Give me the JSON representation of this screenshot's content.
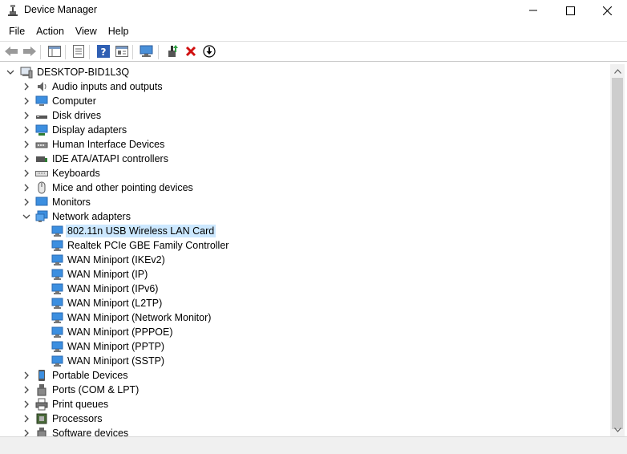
{
  "window": {
    "title": "Device Manager"
  },
  "menu": [
    "File",
    "Action",
    "View",
    "Help"
  ],
  "toolbar": {
    "buttons": [
      "back-icon",
      "forward-icon",
      "properties-icon",
      "refresh-icon",
      "help-icon",
      "view-icon",
      "scan-hardware-icon",
      "update-driver-icon",
      "uninstall-icon",
      "disable-icon"
    ]
  },
  "tree": {
    "root": "DESKTOP-BID1L3Q",
    "categories": [
      {
        "label": "Audio inputs and outputs",
        "icon": "speaker-icon",
        "expanded": false
      },
      {
        "label": "Computer",
        "icon": "computer-icon",
        "expanded": false
      },
      {
        "label": "Disk drives",
        "icon": "disk-drive-icon",
        "expanded": false
      },
      {
        "label": "Display adapters",
        "icon": "display-adapter-icon",
        "expanded": false
      },
      {
        "label": "Human Interface Devices",
        "icon": "hid-icon",
        "expanded": false
      },
      {
        "label": "IDE ATA/ATAPI controllers",
        "icon": "ide-controller-icon",
        "expanded": false
      },
      {
        "label": "Keyboards",
        "icon": "keyboard-icon",
        "expanded": false
      },
      {
        "label": "Mice and other pointing devices",
        "icon": "mouse-icon",
        "expanded": false
      },
      {
        "label": "Monitors",
        "icon": "monitor-icon",
        "expanded": false
      },
      {
        "label": "Network adapters",
        "icon": "network-adapter-icon",
        "expanded": true
      }
    ],
    "network_adapters": [
      {
        "label": "802.11n USB Wireless LAN Card",
        "selected": true
      },
      {
        "label": "Realtek PCIe GBE Family Controller",
        "selected": false
      },
      {
        "label": "WAN Miniport (IKEv2)",
        "selected": false
      },
      {
        "label": "WAN Miniport (IP)",
        "selected": false
      },
      {
        "label": "WAN Miniport (IPv6)",
        "selected": false
      },
      {
        "label": "WAN Miniport (L2TP)",
        "selected": false
      },
      {
        "label": "WAN Miniport (Network Monitor)",
        "selected": false
      },
      {
        "label": "WAN Miniport (PPPOE)",
        "selected": false
      },
      {
        "label": "WAN Miniport (PPTP)",
        "selected": false
      },
      {
        "label": "WAN Miniport (SSTP)",
        "selected": false
      }
    ],
    "categories_after": [
      {
        "label": "Portable Devices",
        "icon": "portable-device-icon"
      },
      {
        "label": "Ports (COM & LPT)",
        "icon": "port-icon"
      },
      {
        "label": "Print queues",
        "icon": "printer-icon"
      },
      {
        "label": "Processors",
        "icon": "processor-icon"
      },
      {
        "label": "Software devices",
        "icon": "software-device-icon"
      }
    ]
  },
  "colors": {
    "selection": "#cce8ff",
    "accent": "#1f7fd1"
  }
}
